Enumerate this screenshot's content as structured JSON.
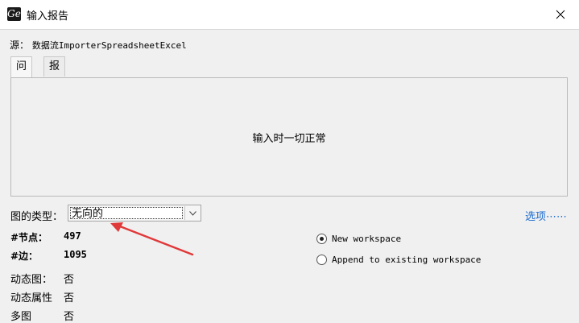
{
  "window": {
    "title": "输入报告",
    "app_icon": "Ge"
  },
  "source": {
    "label": "源：",
    "value": "数据流ImporterSpreadsheetExcel"
  },
  "tabs": [
    {
      "label": "问题",
      "active": true
    },
    {
      "label": "报告",
      "active": false
    }
  ],
  "message": "输入时一切正常",
  "graph_type": {
    "label": "图的类型：",
    "value": "无向的"
  },
  "options_link": "选项⋯⋯",
  "stats": {
    "nodes_label": "#节点：",
    "nodes_value": "497",
    "edges_label": "#边：",
    "edges_value": "1095"
  },
  "properties": [
    {
      "label": "动态图：",
      "value": "否"
    },
    {
      "label": "动态属性",
      "value": "否"
    },
    {
      "label": "多图",
      "value": "否"
    }
  ],
  "workspace_options": [
    {
      "label": "New workspace",
      "selected": true
    },
    {
      "label": "Append to existing workspace",
      "selected": false
    }
  ],
  "colors": {
    "accent_link": "#1a6bd0",
    "annotation_arrow": "#e0393a"
  }
}
